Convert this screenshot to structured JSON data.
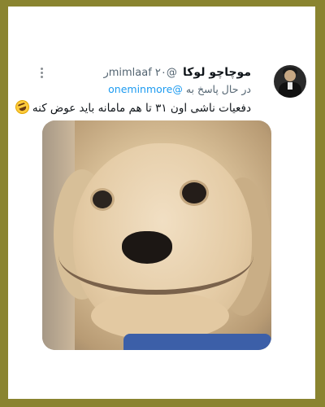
{
  "tweet": {
    "display_name": "موچاچو لوکا",
    "handle": "@mimlaaf",
    "time": "۲۰ر",
    "reply_prefix": "در حال پاسخ به",
    "reply_to": "@oneminmore",
    "text": "دفعیات ناشی اون ۳۱ تا هم مامانه باید عوض کنه",
    "emoji": "rolling-on-floor-laughing"
  },
  "icons": {
    "more": "more-options-icon",
    "emoji": "rofl-emoji-icon"
  },
  "colors": {
    "frame": "#8a8430",
    "card": "#ffffff",
    "link": "#1d9bf0",
    "secondary_text": "#536471"
  }
}
